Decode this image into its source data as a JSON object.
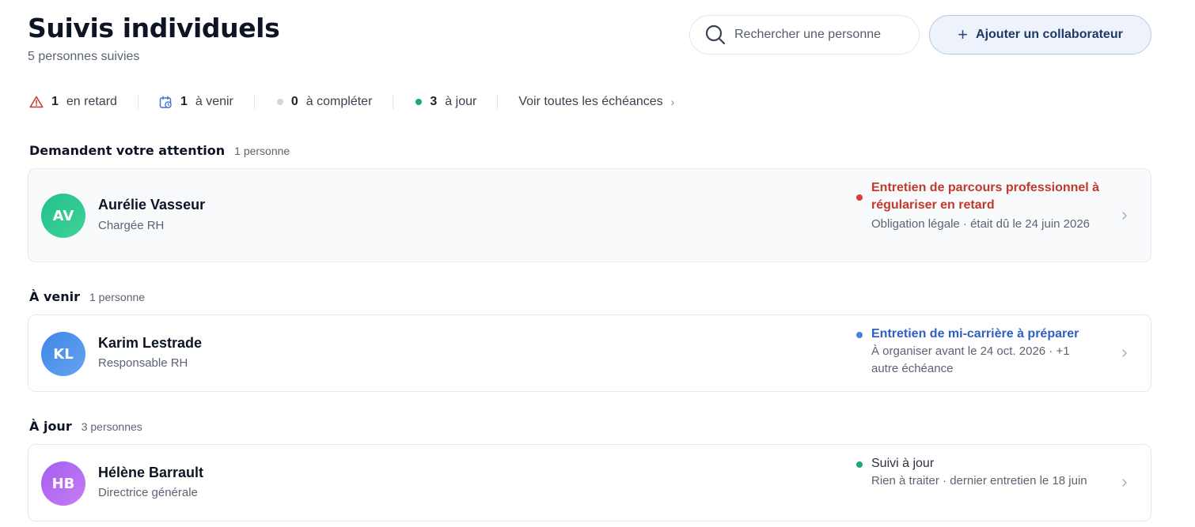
{
  "header": {
    "title": "Suivis individuels",
    "subtitle": "5 personnes suivies",
    "search_placeholder": "Rechercher une personne",
    "add_button_label": "Ajouter un collaborateur"
  },
  "stats": {
    "late": {
      "count": "1",
      "label": "en retard",
      "color": "#c0392b"
    },
    "upcoming": {
      "count": "1",
      "label": "à venir",
      "color": "#3b6fd1"
    },
    "to_complete": {
      "count": "0",
      "label": "à compléter",
      "color": "#cfd6e3"
    },
    "up_to_date": {
      "count": "3",
      "label": "à jour",
      "color": "#1fa870"
    },
    "all_deadlines_link": "Voir toutes les échéances"
  },
  "sections": [
    {
      "title": "Demandent votre attention",
      "count": "1 personne",
      "people": [
        {
          "initials": "AV",
          "name": "Aurélie Vasseur",
          "role": "Chargée RH",
          "status_title": "Entretien de parcours professionnel à régulariser en retard",
          "status_detail": "Obligation légale · était dû le 24 juin 2026",
          "status_color": "#c0392b",
          "dot_color": "#e03b3b",
          "avatar_color": "#2bc48a"
        }
      ]
    },
    {
      "title": "À venir",
      "count": "1 personne",
      "people": [
        {
          "initials": "KL",
          "name": "Karim Lestrade",
          "role": "Responsable RH",
          "status_title": "Entretien de mi-carrière à préparer",
          "status_detail": "À organiser avant le 24 oct. 2026 · +1 autre échéance",
          "status_color": "#2f5fc4",
          "dot_color": "#4a82d8",
          "avatar_color": "#4f92e8"
        }
      ]
    },
    {
      "title": "À jour",
      "count": "3 personnes",
      "people": [
        {
          "initials": "HB",
          "name": "Hélène Barrault",
          "role": "Directrice générale",
          "status_title": "Suivi à jour",
          "status_detail": "Rien à traiter · dernier entretien le 18 juin",
          "status_color": "#2a3240",
          "dot_color": "#1fa870",
          "avatar_color": "#b569ef"
        }
      ]
    }
  ]
}
